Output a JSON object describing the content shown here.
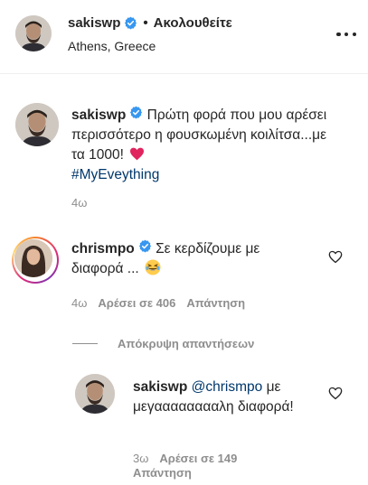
{
  "header": {
    "username": "sakiswp",
    "separator": "•",
    "follow_state": "Ακολουθείτε",
    "location": "Athens, Greece"
  },
  "caption": {
    "username": "sakiswp",
    "text": "Πρώτη φορά που μου αρέσει περισσότερο η φουσκωμένη κοιλίτσα...με τα 1000!",
    "hashtag": "#MyEveything",
    "time": "4ω"
  },
  "comments": [
    {
      "username": "chrismpo",
      "text": "Σε κερδίζουμε με διαφορά ...",
      "time": "4ω",
      "likes": "Αρέσει σε 406",
      "reply": "Απάντηση"
    }
  ],
  "hide_replies": "Απόκρυψη απαντήσεων",
  "replies": [
    {
      "username": "sakiswp",
      "mention": "@chrismpo",
      "text": "με μεγααααααααλη διαφορά!",
      "time": "3ω",
      "likes": "Αρέσει σε 149",
      "reply": "Απάντηση"
    }
  ],
  "icons": {
    "verified": "verified-badge-icon",
    "more": "more-options-icon",
    "heart_red": "red-heart-emoji",
    "laugh": "laughing-emoji",
    "heart_outline": "like-heart-icon"
  },
  "colors": {
    "verified_blue": "#3897f0",
    "link": "#00376b",
    "secondary_text": "#8e8e8e",
    "heart_red": "#e0245e"
  }
}
